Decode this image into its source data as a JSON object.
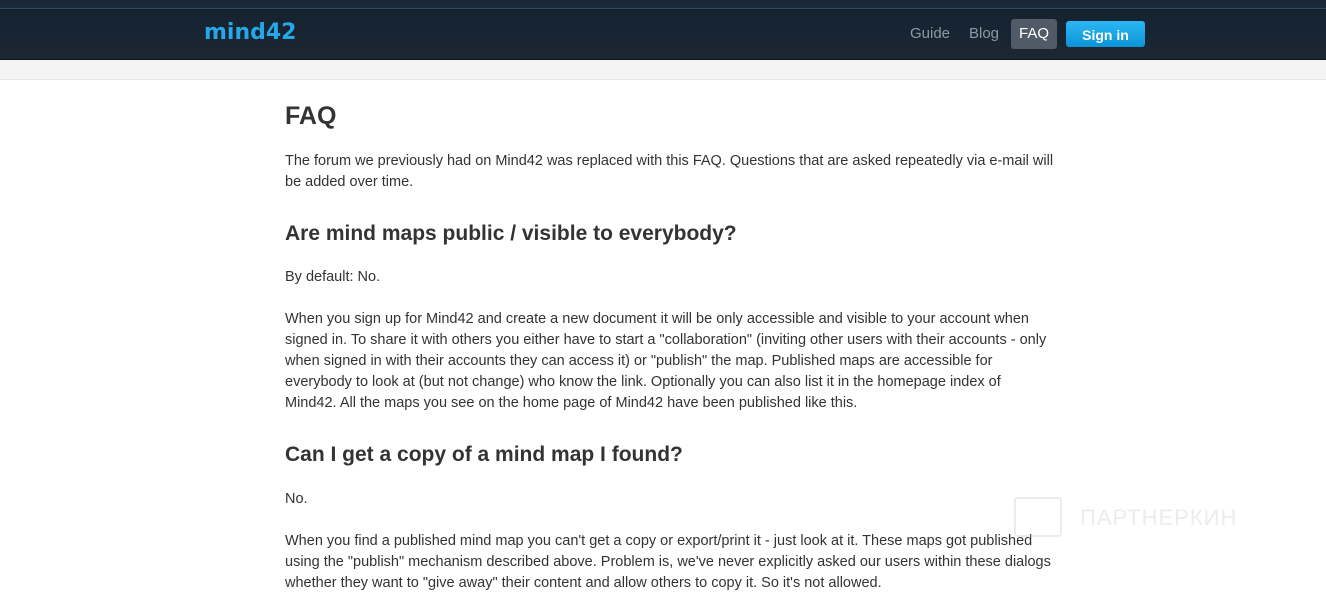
{
  "header": {
    "logo_text": "mind42",
    "nav": [
      {
        "label": "Guide"
      },
      {
        "label": "Blog"
      },
      {
        "label": "FAQ",
        "active": true
      }
    ],
    "signin_label": "Sign in"
  },
  "page": {
    "title": "FAQ",
    "intro": "The forum we previously had on Mind42 was replaced with this FAQ. Questions that are asked repeatedly via e-mail will be added over time.",
    "sections": [
      {
        "question": "Are mind maps public / visible to everybody?",
        "paragraphs": [
          "By default: No.",
          "When you sign up for Mind42 and create a new document it will be only accessible and visible to your account when signed in. To share it with others you either have to start a \"collaboration\" (inviting other users with their accounts - only when signed in with their accounts they can access it) or \"publish\" the map. Published maps are accessible for everybody to look at (but not change) who know the link. Optionally you can also list it in the homepage index of Mind42. All the maps you see on the home page of Mind42 have been published like this."
        ]
      },
      {
        "question": "Can I get a copy of a mind map I found?",
        "paragraphs": [
          "No.",
          "When you find a published mind map you can't get a copy or export/print it - just look at it. These maps got published using the \"publish\" mechanism described above. Problem is, we've never explicitly asked our users within these dialogs whether they want to \"give away\" their content and allow others to copy it. So it's not allowed."
        ]
      }
    ]
  },
  "watermark": {
    "text": "ПАРТНЕРКИН"
  },
  "colors": {
    "topbar": "#1b2733",
    "accent": "#27a6e8",
    "signin_button": "#1aa5e8",
    "active_nav": "#505b67",
    "text": "#333333"
  }
}
